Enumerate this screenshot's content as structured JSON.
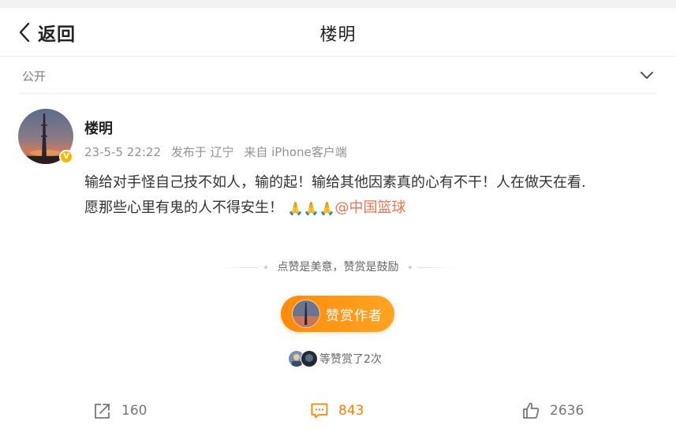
{
  "header": {
    "back_label": "返回",
    "title": "楼明"
  },
  "visibility": {
    "label": "公开",
    "chevron_icon": "chevron-down-icon"
  },
  "post": {
    "author": "楼明",
    "verified_badge": "V",
    "verified_color": "#f7b500",
    "time": "23-5-5 22:22",
    "location": "发布于 辽宁",
    "source": "来自 iPhone客户端",
    "text_part1": "输给对手怪自己技不如人，输的起！输给其他因素真的心有不干！人在做天在看.",
    "text_part2": "愿那些心里有鬼的人不得安生！",
    "emoji": "🙏",
    "mention": "@中国篮球",
    "mention_color": "#eb7350"
  },
  "reward": {
    "slogan": "点赞是美意，赞赏是鼓励",
    "button_label": "赞赏作者",
    "button_color": "#ff8a0a",
    "rewarders_text": "等赞赏了2次"
  },
  "actions": {
    "repost": {
      "icon": "share-icon",
      "count": "160"
    },
    "comment": {
      "icon": "comment-icon",
      "count": "843",
      "color": "#ff8200"
    },
    "like": {
      "icon": "thumbs-up-icon",
      "count": "2636"
    }
  }
}
